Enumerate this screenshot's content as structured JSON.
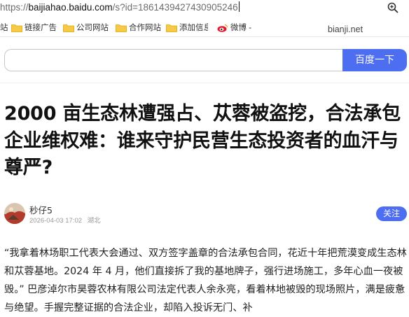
{
  "browser": {
    "url_scheme": "https://",
    "url_host": "baijiahao.baidu.com",
    "url_rest": "/s?id=1861439427430905246",
    "zoom_icon": "magnifier-icon",
    "bookmarks": [
      {
        "label": "站",
        "icon": "none"
      },
      {
        "label": "链接广告",
        "icon": "folder-icon"
      },
      {
        "label": "公司网站",
        "icon": "folder-icon"
      },
      {
        "label": "合作网站",
        "icon": "folder-icon"
      },
      {
        "label": "添加信息",
        "icon": "folder-icon"
      },
      {
        "label": "微博 -",
        "icon": "weibo-icon"
      }
    ],
    "bookmark_right": "bianji.net"
  },
  "search": {
    "value": "",
    "button_label": "百度一下",
    "accent": "#4e6ef2"
  },
  "article": {
    "title": "2000 亩生态林遭强占、苁蓉被盗挖，合法承包企业维权难：谁来守护民营生态投资者的血汗与尊严?",
    "author": "秒仔5",
    "date": "2026-04-03 17:02",
    "location": "湖北",
    "follow_label": "关注",
    "paragraph": "“我拿着林场职工代表大会通过、双方签字盖章的合法承包合同，花近十年把荒漠变成生态林和苁蓉基地。2024 年 4 月，他们直接拆了我的基地牌子，强行进场施工，多年心血一夜被毁。” 巴彦淖尔市昊蓉农林有限公司法定代表人余永亮，看着林地被毁的现场照片，满是疲惫与绝望。手握完整证据的合法企业，却陷入投诉无门、补"
  }
}
